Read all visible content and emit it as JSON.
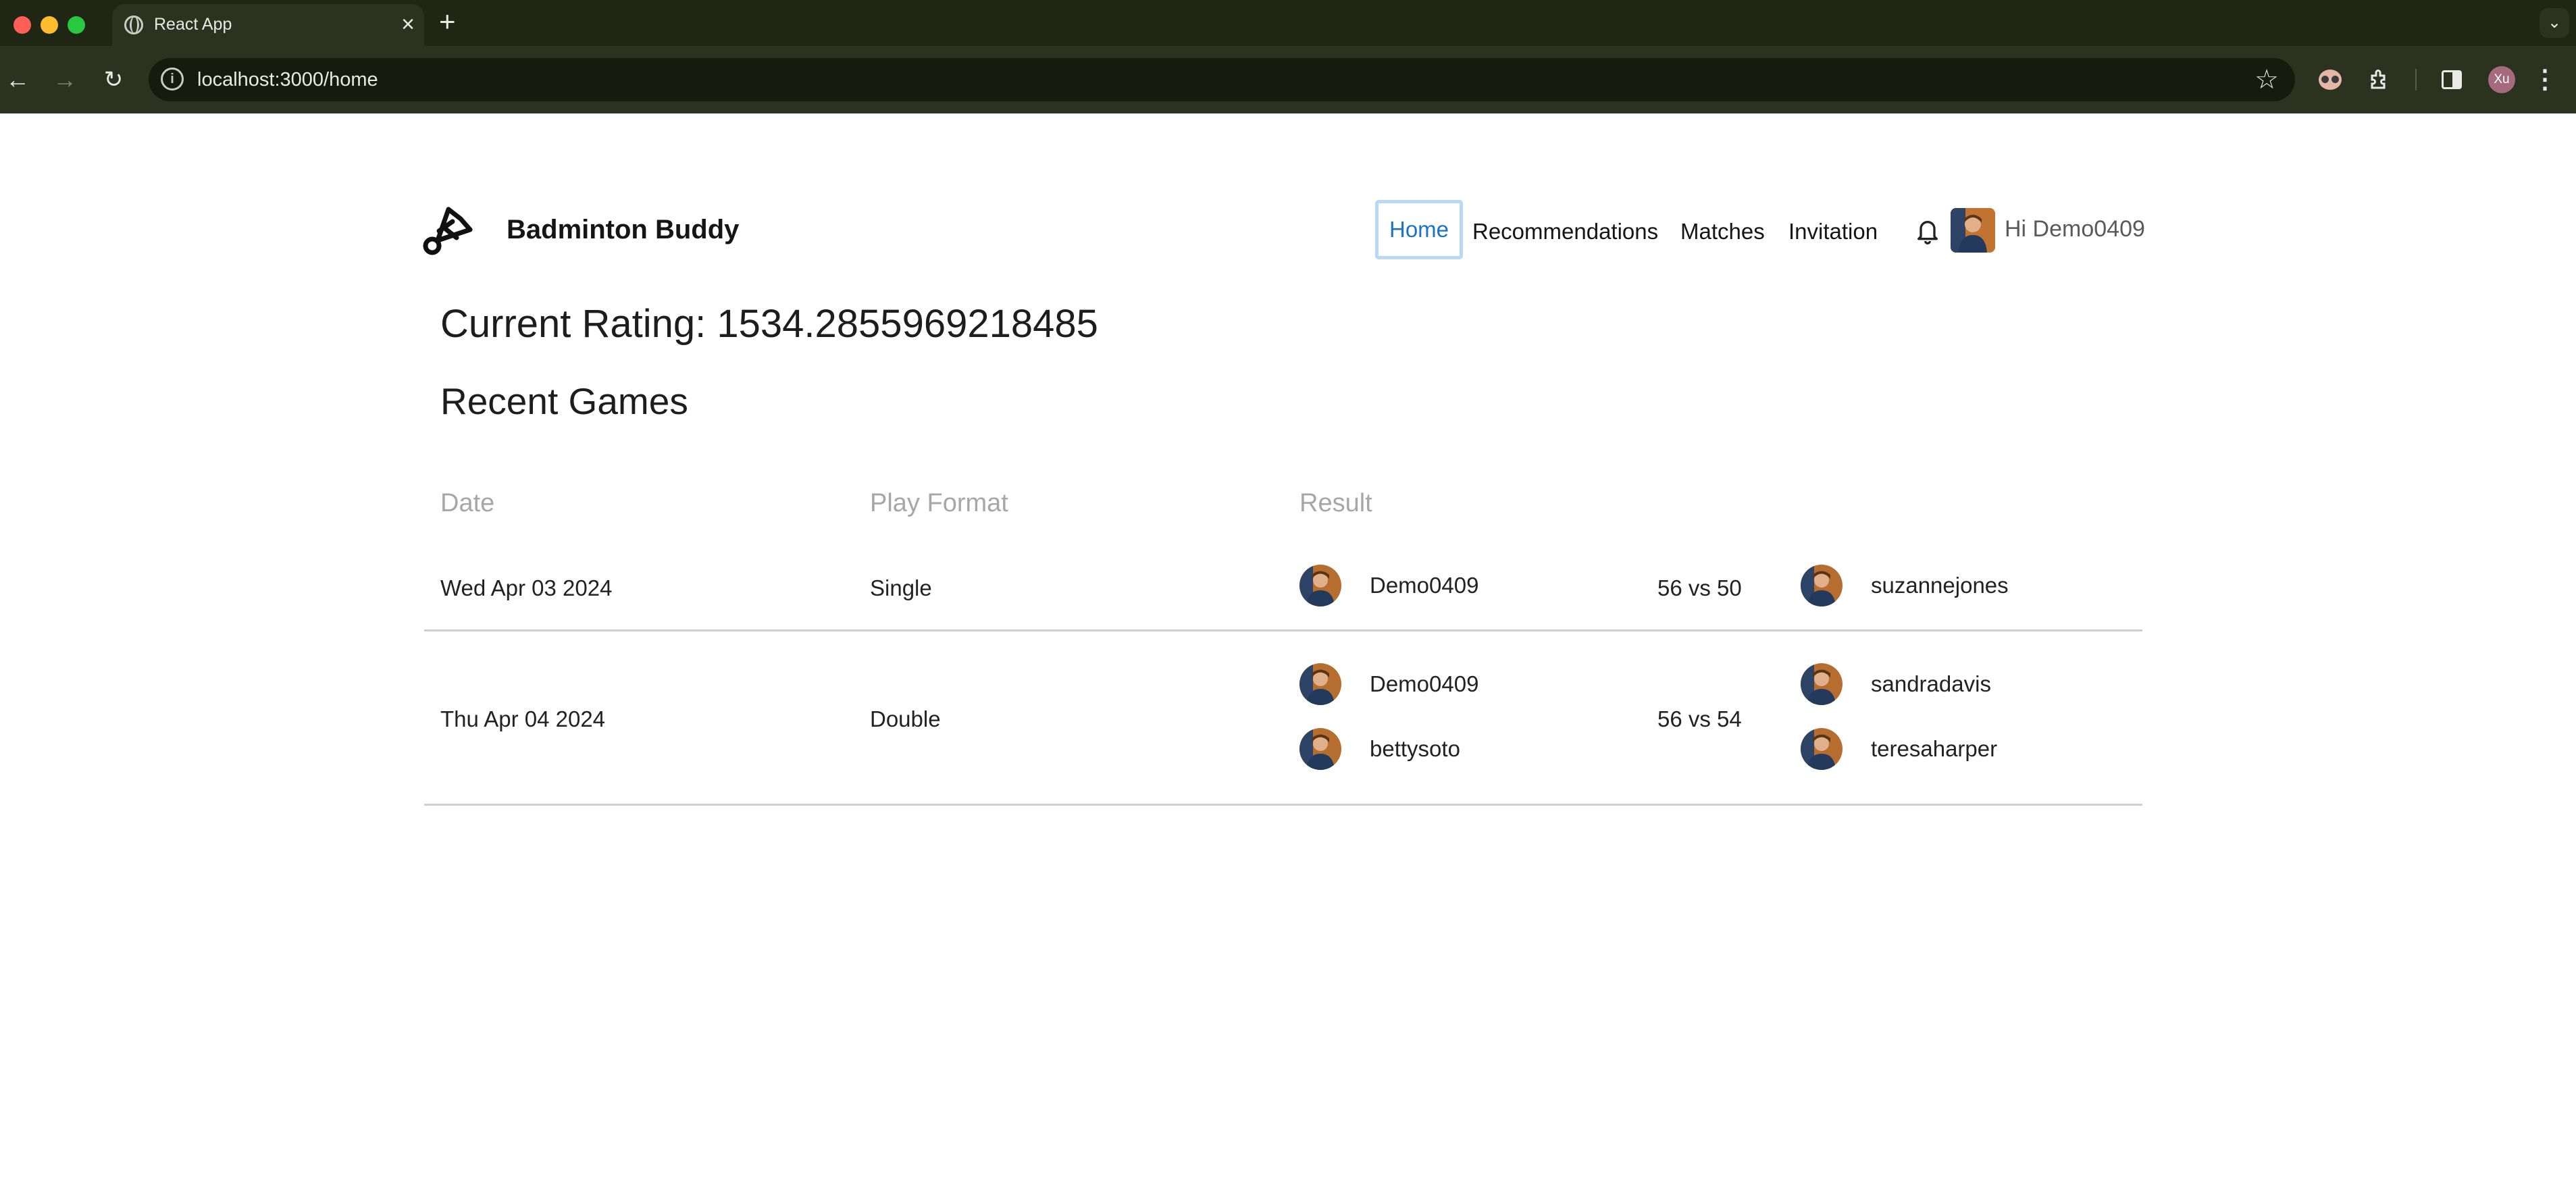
{
  "browser": {
    "tab_title": "React App",
    "new_tab_symbol": "+",
    "url": "localhost:3000/home",
    "profile_initials": "Xu",
    "icons": [
      "globe-icon",
      "close-icon",
      "plus-icon",
      "chevron-down-icon",
      "back-arrow-icon",
      "forward-arrow-icon",
      "reload-icon",
      "info-icon",
      "star-icon",
      "extension-face-icon",
      "puzzle-extensions-icon",
      "side-panel-icon",
      "kebab-menu-icon"
    ]
  },
  "header": {
    "brand": "Badminton Buddy",
    "nav": {
      "home": "Home",
      "recommendations": "Recommendations",
      "matches": "Matches",
      "invitation": "Invitation"
    },
    "greeting": "Hi Demo0409",
    "active_nav": "Home",
    "accent_color": "#1a73c9"
  },
  "main": {
    "rating_text": "Current Rating: 1534.2855969218485",
    "recent_title": "Recent Games",
    "columns": {
      "date": "Date",
      "format": "Play Format",
      "result": "Result"
    },
    "games": [
      {
        "date": "Wed Apr 03 2024",
        "format": "Single",
        "team_a": [
          "Demo0409"
        ],
        "score": "56 vs 50",
        "team_b": [
          "suzannejones"
        ]
      },
      {
        "date": "Thu Apr 04 2024",
        "format": "Double",
        "team_a": [
          "Demo0409",
          "bettysoto"
        ],
        "score": "56 vs 54",
        "team_b": [
          "sandradavis",
          "teresaharper"
        ]
      }
    ]
  }
}
